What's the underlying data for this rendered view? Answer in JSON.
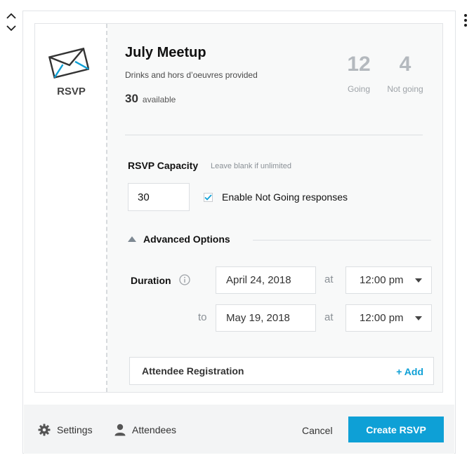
{
  "event": {
    "block_label": "RSVP",
    "title": "July Meetup",
    "description": "Drinks and hors d’oeuvres provided",
    "available_count": "30",
    "available_label": "available",
    "going_count": "12",
    "going_label": "Going",
    "not_going_count": "4",
    "not_going_label": "Not going"
  },
  "capacity": {
    "title": "RSVP Capacity",
    "hint": "Leave blank if unlimited",
    "value": "30",
    "not_going_checkbox_label": "Enable Not Going responses",
    "not_going_checked": true
  },
  "advanced": {
    "toggle_label": "Advanced Options",
    "duration_label": "Duration",
    "start_date": "April 24, 2018",
    "end_date": "May 19, 2018",
    "at_label": "at",
    "to_label": "to",
    "start_time": "12:00 pm",
    "end_time": "12:00 pm"
  },
  "registration": {
    "title": "Attendee Registration",
    "add_label": "+ Add"
  },
  "footer": {
    "settings_label": "Settings",
    "attendees_label": "Attendees",
    "cancel_label": "Cancel",
    "create_label": "Create RSVP"
  },
  "colors": {
    "accent": "#0ea0d6",
    "stat_gray": "#b4b9be"
  }
}
